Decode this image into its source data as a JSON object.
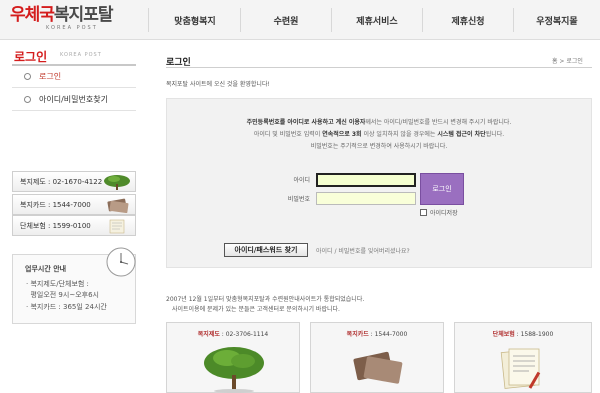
{
  "logo": {
    "main_red": "우체국",
    "main_dark": "복지포탈",
    "sub": "KOREA POST"
  },
  "nav": [
    "맞춤형복지",
    "수련원",
    "제휴서비스",
    "제휴신청",
    "우정복지몰"
  ],
  "sidebar": {
    "title": "로그인",
    "title_en": "KOREA POST",
    "items": [
      {
        "label": "로그인"
      },
      {
        "label": "아이디/비밀번호찾기"
      }
    ],
    "contacts": [
      {
        "label": "복지제도 : 02-1670-4122"
      },
      {
        "label": "복지카드 : 1544-7000"
      },
      {
        "label": "단체보험 : 1599-0100"
      }
    ],
    "hours": {
      "title": "업무시간 안내",
      "lines": [
        "· 복지제도/단체보험 :",
        "  평일오전 9시~오후6시",
        "· 복지카드 : 365일 24시간"
      ]
    }
  },
  "main": {
    "title": "로그인",
    "breadcrumb": "홈 > 로그인",
    "welcome": "복지포탈 사이트에 오신 것을 환영합니다!",
    "notice": {
      "line1_pre": "주민등록번호를 아이디로 사용하고 계신 이용자",
      "line1_post": "께서는 아이디/비밀번호를 반드시 변경해 주시기 바랍니다.",
      "line2_pre": "아이디 및 비밀번호 입력이 ",
      "line2_bold1": "연속적으로 3회",
      "line2_mid": " 이상 일치하지 않을 경우에는 ",
      "line2_bold2": "시스템 접근이 차단",
      "line2_post": "됩니다.",
      "line3": "비밀번호는 주기적으로 변경하여 사용하시기 바랍니다."
    },
    "form": {
      "id_label": "아이디",
      "pw_label": "비밀번호",
      "id_value": "",
      "pw_value": "",
      "login_label": "로그인",
      "save_id_label": "아이디저장",
      "find_label": "아이디/패스워드 찾기",
      "forgot_text": "아이디 / 비밀번호를 잊어버리셨나요?"
    },
    "info": [
      "2007년 12월 1일부터 맞춤형복지포탈과 수련원안내사이트가 통합되었습니다.",
      "사이트이용에 문제가 있는 분들은 고객센터로 문의하시기 바랍니다."
    ],
    "cards": [
      {
        "key": "복지제도",
        "phone": " : 02-3706-1114",
        "icon": "tree-icon"
      },
      {
        "key": "복지카드",
        "phone": " : 1544-7000",
        "icon": "cards-icon"
      },
      {
        "key": "단체보험",
        "phone": " : 1588-1900",
        "icon": "documents-icon"
      }
    ]
  }
}
